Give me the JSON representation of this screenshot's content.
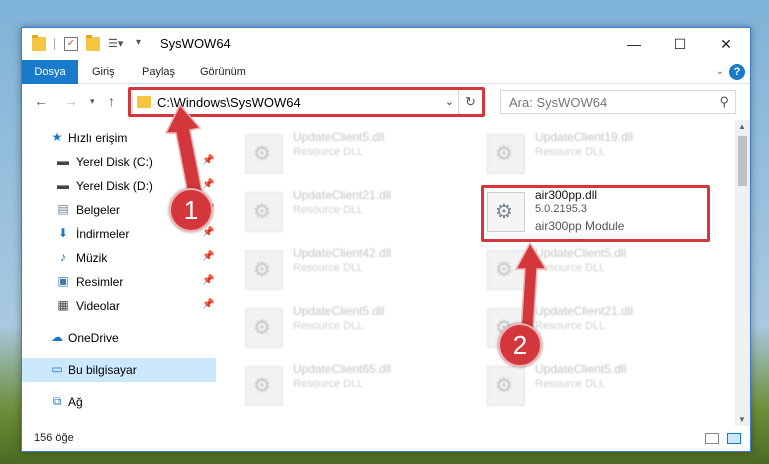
{
  "window": {
    "title": "SysWOW64"
  },
  "ribbon": {
    "tabs": [
      "Dosya",
      "Giriş",
      "Paylaş",
      "Görünüm"
    ],
    "help": "?"
  },
  "address": {
    "path": "C:\\Windows\\SysWOW64",
    "search_placeholder": "Ara: SysWOW64"
  },
  "sidebar": {
    "items": [
      {
        "label": "Hızlı erişim",
        "icon": "star-icon",
        "pinned": false
      },
      {
        "label": "Yerel Disk (C:)",
        "icon": "drive-icon",
        "pinned": true
      },
      {
        "label": "Yerel Disk (D:)",
        "icon": "drive-icon",
        "pinned": true
      },
      {
        "label": "Belgeler",
        "icon": "document-icon",
        "pinned": true
      },
      {
        "label": "İndirmeler",
        "icon": "download-icon",
        "pinned": true
      },
      {
        "label": "Müzik",
        "icon": "music-icon",
        "pinned": true
      },
      {
        "label": "Resimler",
        "icon": "picture-icon",
        "pinned": true
      },
      {
        "label": "Videolar",
        "icon": "video-icon",
        "pinned": true
      },
      {
        "label": "OneDrive",
        "icon": "cloud-icon",
        "pinned": false
      },
      {
        "label": "Bu bilgisayar",
        "icon": "computer-icon",
        "pinned": false,
        "selected": true
      },
      {
        "label": "Ağ",
        "icon": "network-icon",
        "pinned": false
      }
    ]
  },
  "files": [
    {
      "name": "UpdateClient5.dll",
      "desc": "Resource DLL"
    },
    {
      "name": "UpdateClient19.dll",
      "desc": "Resource DLL"
    },
    {
      "name": "UpdateClient21.dll",
      "desc": "Resource DLL"
    },
    {
      "name": "UpdateClient42.dll",
      "desc": "Resource DLL"
    },
    {
      "name": "UpdateClient5.dll",
      "desc": "Resource DLL"
    },
    {
      "name": "UpdateClient5.dll",
      "desc": "Resource DLL"
    },
    {
      "name": "UpdateClient21.dll",
      "desc": "Resource DLL"
    },
    {
      "name": "UpdateClient65.dll",
      "desc": "Resource DLL"
    },
    {
      "name": "UpdateClient5.dll",
      "desc": "Resource DLL"
    }
  ],
  "highlighted_file": {
    "name": "air300pp.dll",
    "version": "5.0.2195.3",
    "desc": "air300pp Module"
  },
  "status": {
    "count": "156 öğe"
  },
  "annotations": {
    "step1": "1",
    "step2": "2",
    "color": "#d3373b"
  }
}
